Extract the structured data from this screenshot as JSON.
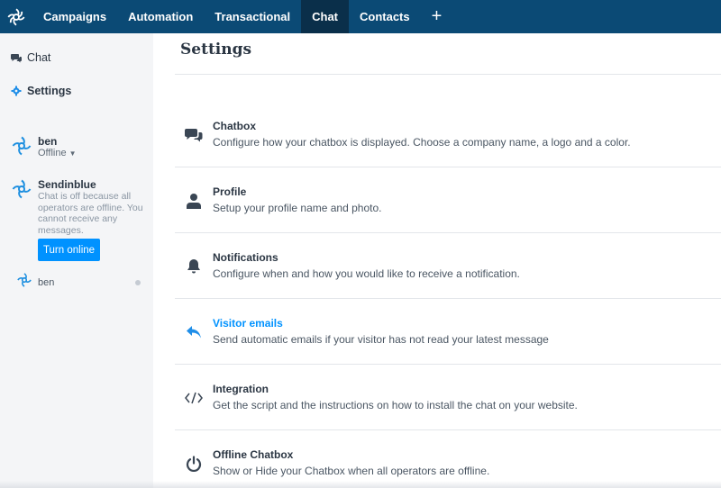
{
  "topbar": {
    "logo_icon": "sendinblue-logo-icon",
    "nav": [
      {
        "label": "Campaigns",
        "active": false
      },
      {
        "label": "Automation",
        "active": false
      },
      {
        "label": "Transactional",
        "active": false
      },
      {
        "label": "Chat",
        "active": true
      },
      {
        "label": "Contacts",
        "active": false
      }
    ],
    "plus_label": "+",
    "bg_color": "#0b4a75",
    "active_color": "#0a2f4a"
  },
  "sidebar": {
    "links": [
      {
        "label": "Chat",
        "icon": "chat-bubbles-icon"
      },
      {
        "label": "Settings",
        "icon": "gear-icon"
      }
    ],
    "current_operator": {
      "name": "ben",
      "status": "Offline"
    },
    "company": {
      "name": "Sendinblue",
      "message": "Chat is off because all operators are offline. You cannot receive any messages.",
      "button": "Turn online"
    },
    "agents": [
      {
        "name": "ben"
      }
    ]
  },
  "main": {
    "title": "Settings",
    "rows": [
      {
        "title": "Chatbox",
        "desc": "Configure how your chatbox is displayed. Choose a company name, a logo and a color.",
        "icon": "chat-bubbles-icon"
      },
      {
        "title": "Profile",
        "desc": "Setup your profile name and photo.",
        "icon": "user-icon"
      },
      {
        "title": "Notifications",
        "desc": "Configure when and how you would like to receive a notification.",
        "icon": "bell-icon"
      },
      {
        "title": "Visitor emails",
        "desc": "Send automatic emails if your visitor has not read your latest message",
        "icon": "reply-arrow-icon"
      },
      {
        "title": "Integration",
        "desc": "Get the script and the instructions on how to install the chat on your website.",
        "icon": "code-icon"
      },
      {
        "title": "Offline Chatbox",
        "desc": "Show or Hide your Chatbox when all operators are offline.",
        "icon": "power-icon"
      }
    ],
    "accent_color": "#0092ff"
  }
}
